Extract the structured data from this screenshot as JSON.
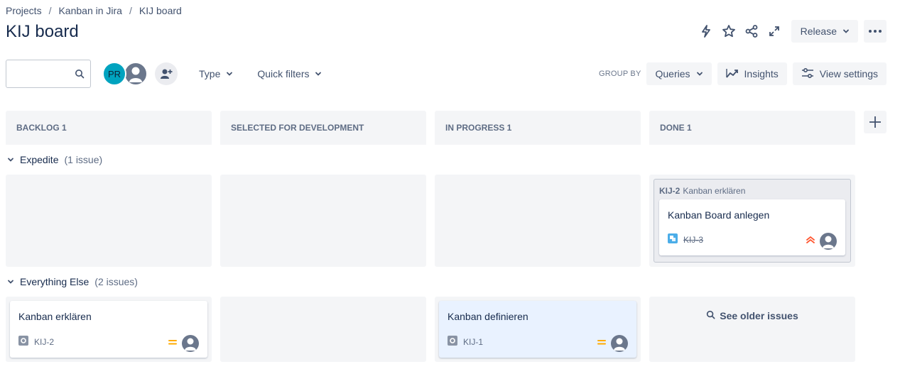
{
  "breadcrumb": {
    "items": [
      "Projects",
      "Kanban in Jira",
      "KIJ board"
    ],
    "separator": "/"
  },
  "page": {
    "title": "KIJ board"
  },
  "header": {
    "release_label": "Release",
    "icons": [
      "lightning-icon",
      "star-icon",
      "share-icon",
      "expand-icon",
      "more-icon"
    ]
  },
  "toolbar": {
    "search_placeholder": "",
    "avatar_initials": "PR",
    "type_label": "Type",
    "quick_filters_label": "Quick filters",
    "group_by_label": "GROUP BY",
    "group_by_value": "Queries",
    "insights_label": "Insights",
    "view_settings_label": "View settings"
  },
  "columns": [
    {
      "title": "BACKLOG 1"
    },
    {
      "title": "SELECTED FOR DEVELOPMENT"
    },
    {
      "title": "IN PROGRESS 1"
    },
    {
      "title": "DONE 1"
    }
  ],
  "swimlanes": [
    {
      "name": "Expedite",
      "count": "(1 issue)",
      "parent": {
        "key": "KIJ-2",
        "summary": "Kanban erklären",
        "subtask": {
          "title": "Kanban Board anlegen",
          "key": "KIJ-3",
          "issue_type": "subtask",
          "priority": "highest"
        }
      }
    },
    {
      "name": "Everything Else",
      "count": "(2 issues)",
      "cards": [
        {
          "title": "Kanban erklären",
          "key": "KIJ-2",
          "issue_type": "epic-ish",
          "priority": "medium"
        },
        {
          "title": "Kanban definieren",
          "key": "KIJ-1",
          "issue_type": "epic-ish",
          "priority": "medium"
        }
      ],
      "see_older_label": "See older issues"
    }
  ],
  "colors": {
    "accent": "#0052cc",
    "priority_medium": "#ffab00",
    "priority_highest": "#ff5630",
    "subtask_blue": "#4bade8",
    "avatar_teal": "#00a3bf"
  }
}
